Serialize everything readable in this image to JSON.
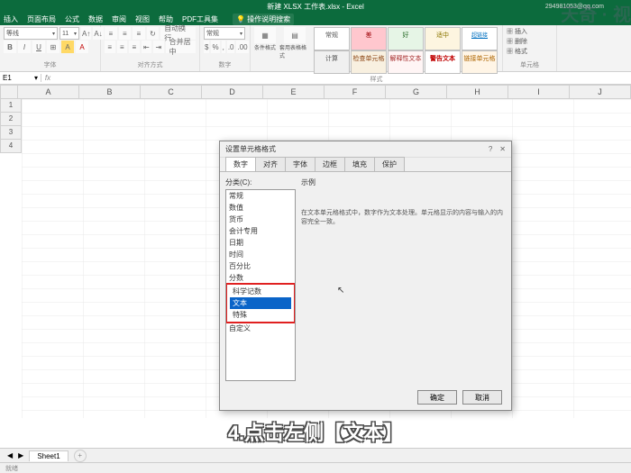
{
  "title": "新建 XLSX 工作表.xlsx - Excel",
  "email": "294981053@qq.com",
  "menu": [
    "插入",
    "页面布局",
    "公式",
    "数据",
    "审阅",
    "视图",
    "帮助",
    "PDF工具集"
  ],
  "tellme": "操作说明搜索",
  "ribbon": {
    "font_name": "等线",
    "font_size": "11",
    "group_font": "字体",
    "group_align": "对齐方式",
    "group_number": "数字",
    "group_styles": "样式",
    "group_cells": "单元格",
    "wrap": "自动换行",
    "merge": "合并居中",
    "numfmt": "常规",
    "condfmt": "条件格式",
    "astable": "套用表格格式",
    "s_normal": "常规",
    "s_bad": "差",
    "s_good": "好",
    "s_neutral": "适中",
    "s_hyperlink": "超链接",
    "s_calc": "计算",
    "s_check": "检查单元格",
    "s_explain": "解释性文本",
    "s_warn": "警告文本",
    "s_linked": "链接单元格",
    "insert": "插入",
    "delete": "删除",
    "format": "格式"
  },
  "namebox": "E1",
  "cols": [
    "A",
    "B",
    "C",
    "D",
    "E",
    "F",
    "G",
    "H",
    "I",
    "J"
  ],
  "rows": [
    "1",
    "2",
    "3",
    "4"
  ],
  "dialog": {
    "title": "设置单元格格式",
    "tabs": [
      "数字",
      "对齐",
      "字体",
      "边框",
      "填充",
      "保护"
    ],
    "cat_label": "分类(C):",
    "cats": [
      "常规",
      "数值",
      "货币",
      "会计专用",
      "日期",
      "时间",
      "百分比",
      "分数",
      "科学记数",
      "文本",
      "特殊",
      "自定义"
    ],
    "selected_index": 9,
    "example": "示例",
    "desc": "在文本单元格格式中，数字作为文本处理。单元格显示的内容与输入的内容完全一致。",
    "ok": "确定",
    "cancel": "取消"
  },
  "caption": "4.点击左侧【文本】",
  "sheet": "Sheet1",
  "ready": "就绪",
  "watermark": "天奇 · 视"
}
